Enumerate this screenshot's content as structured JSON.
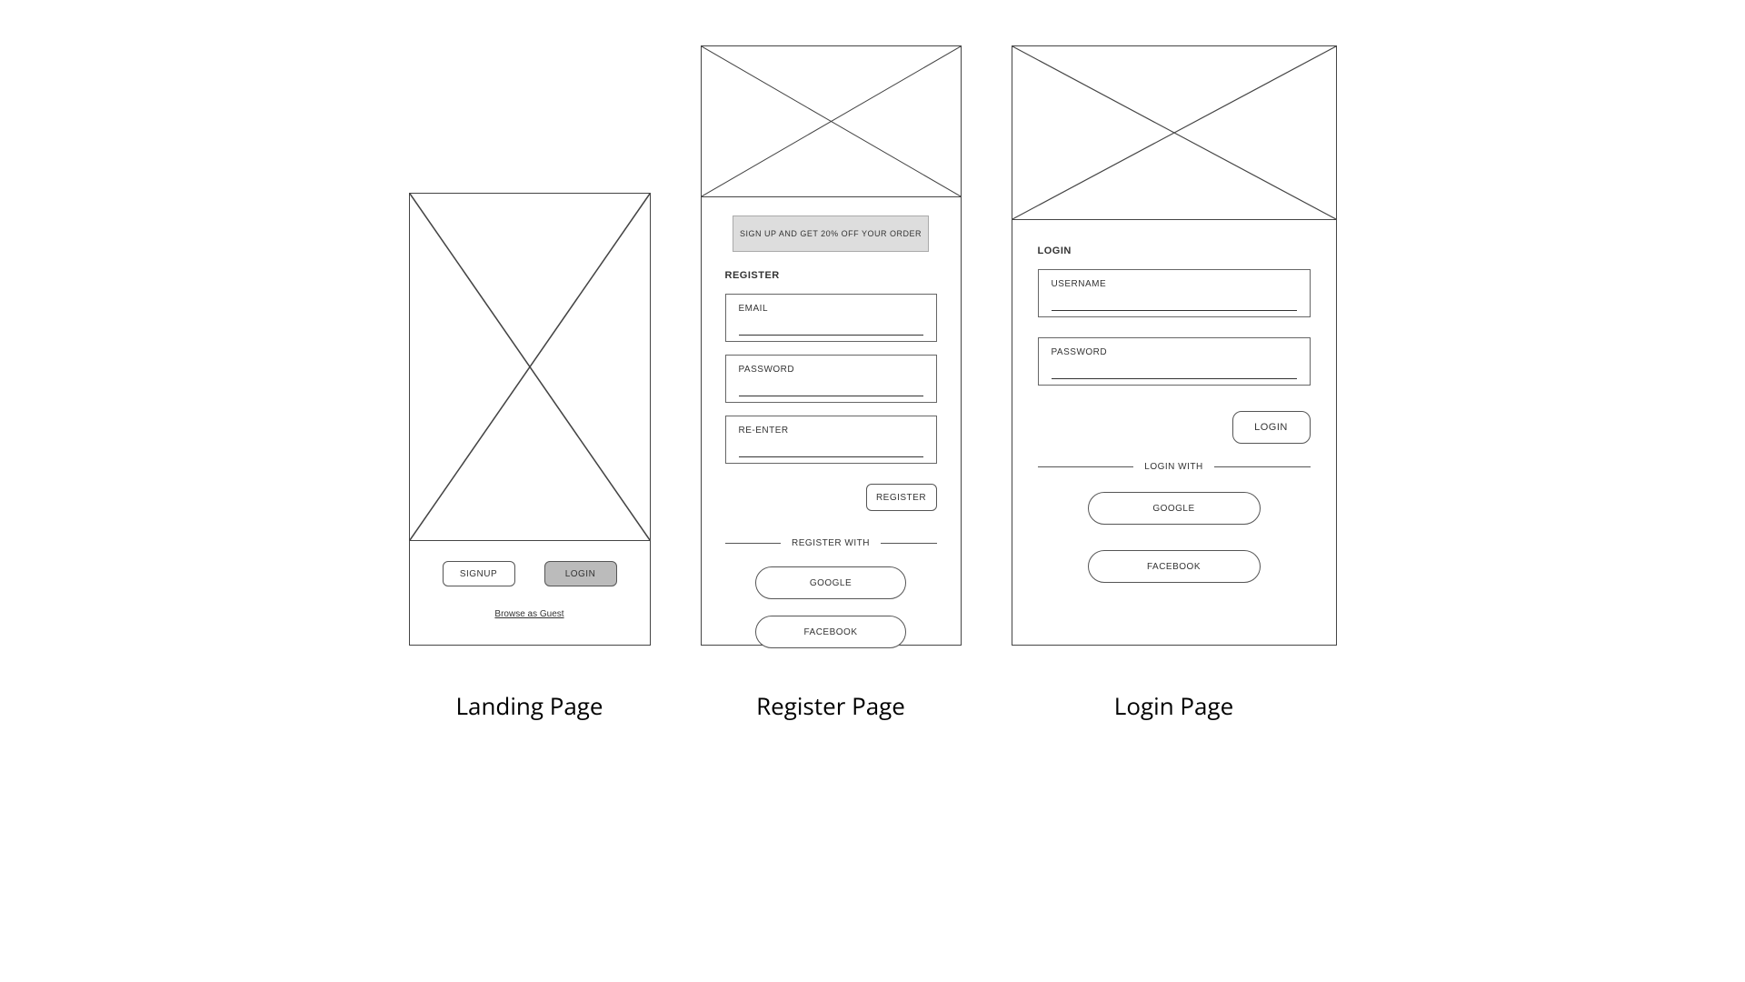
{
  "landing": {
    "caption": "Landing Page",
    "signup_label": "SIGNUP",
    "login_label": "LOGIN",
    "guest_link": "Browse as Guest"
  },
  "register": {
    "caption": "Register Page",
    "banner": "SIGN UP AND GET 20% OFF YOUR ORDER",
    "title": "REGISTER",
    "field_email": "EMAIL",
    "field_password": "PASSWORD",
    "field_reenter": "RE-ENTER",
    "submit_label": "REGISTER",
    "divider_label": "REGISTER WITH",
    "google_label": "GOOGLE",
    "facebook_label": "FACEBOOK"
  },
  "login": {
    "caption": "Login Page",
    "title": "LOGIN",
    "field_username": "USERNAME",
    "field_password": "PASSWORD",
    "submit_label": "LOGIN",
    "divider_label": "LOGIN WITH",
    "google_label": "GOOGLE",
    "facebook_label": "FACEBOOK"
  }
}
